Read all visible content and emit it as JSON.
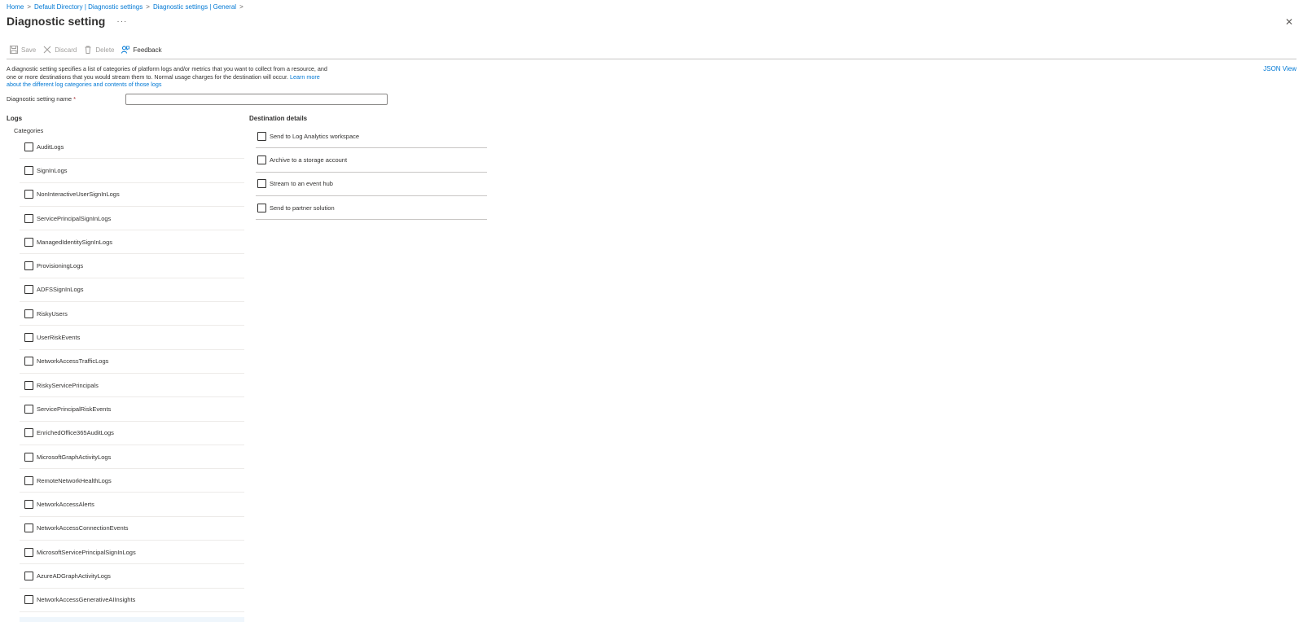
{
  "breadcrumb": [
    {
      "label": "Home"
    },
    {
      "label": "Default Directory | Diagnostic settings"
    },
    {
      "label": "Diagnostic settings | General"
    }
  ],
  "page_title": "Diagnostic setting",
  "more_glyph": "···",
  "close_glyph": "✕",
  "toolbar": {
    "save_label": "Save",
    "discard_label": "Discard",
    "delete_label": "Delete",
    "feedback_label": "Feedback"
  },
  "description": {
    "text": "A diagnostic setting specifies a list of categories of platform logs and/or metrics that you want to collect from a resource, and one or more destinations that you would stream them to. Normal usage charges for the destination will occur. ",
    "link": "Learn more about the different log categories and contents of those logs"
  },
  "json_view_label": "JSON View",
  "name_field": {
    "label": "Diagnostic setting name",
    "required_marker": "*",
    "value": "",
    "placeholder": ""
  },
  "logs": {
    "heading": "Logs",
    "categories_label": "Categories",
    "categories": [
      "AuditLogs",
      "SignInLogs",
      "NonInteractiveUserSignInLogs",
      "ServicePrincipalSignInLogs",
      "ManagedIdentitySignInLogs",
      "ProvisioningLogs",
      "ADFSSignInLogs",
      "RiskyUsers",
      "UserRiskEvents",
      "NetworkAccessTrafficLogs",
      "RiskyServicePrincipals",
      "ServicePrincipalRiskEvents",
      "EnrichedOffice365AuditLogs",
      "MicrosoftGraphActivityLogs",
      "RemoteNetworkHealthLogs",
      "NetworkAccessAlerts",
      "NetworkAccessConnectionEvents",
      "MicrosoftServicePrincipalSignInLogs",
      "AzureADGraphActivityLogs",
      "NetworkAccessGenerativeAIInsights"
    ]
  },
  "destination": {
    "heading": "Destination details",
    "options": [
      "Send to Log Analytics workspace",
      "Archive to a storage account",
      "Stream to an event hub",
      "Send to partner solution"
    ]
  }
}
